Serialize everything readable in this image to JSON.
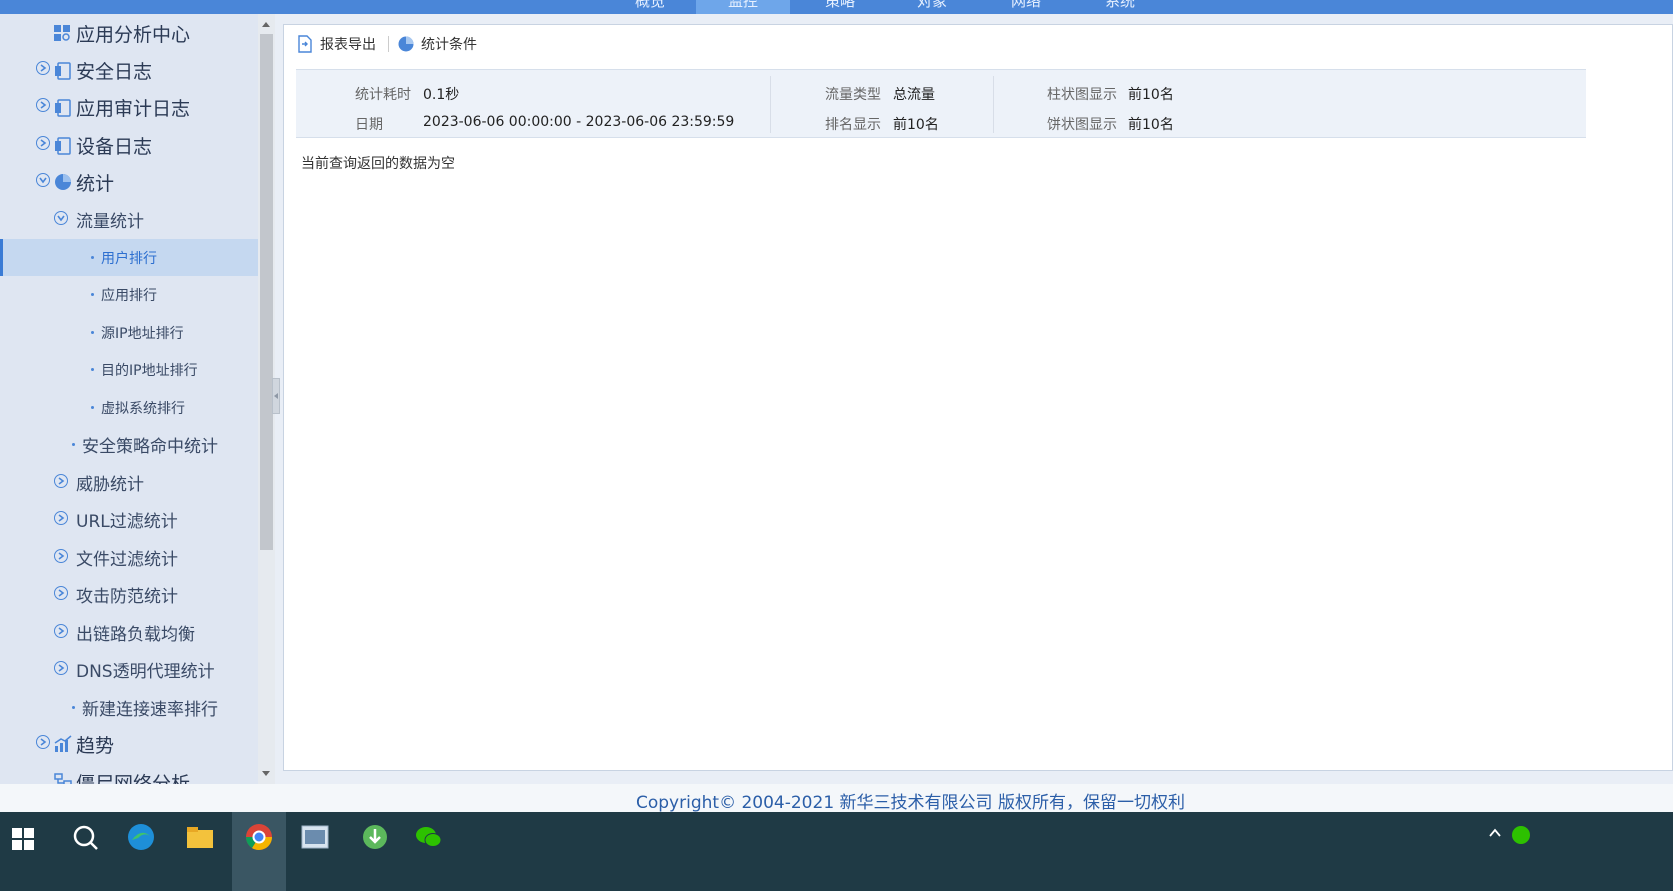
{
  "topnav": {
    "tabs": [
      {
        "label": "概览",
        "active": false
      },
      {
        "label": "监控",
        "active": true
      },
      {
        "label": "策略",
        "active": false
      },
      {
        "label": "对象",
        "active": false
      },
      {
        "label": "网络",
        "active": false
      },
      {
        "label": "系统",
        "active": false
      }
    ]
  },
  "sidebar": {
    "items": [
      {
        "label": "应用分析中心",
        "level": 1
      },
      {
        "label": "安全日志",
        "level": 1
      },
      {
        "label": "应用审计日志",
        "level": 1
      },
      {
        "label": "设备日志",
        "level": 1
      },
      {
        "label": "统计",
        "level": 1
      },
      {
        "label": "流量统计",
        "level": 2
      },
      {
        "label": "用户排行",
        "level": 3,
        "active": true
      },
      {
        "label": "应用排行",
        "level": 3
      },
      {
        "label": "源IP地址排行",
        "level": 3
      },
      {
        "label": "目的IP地址排行",
        "level": 3
      },
      {
        "label": "虚拟系统排行",
        "level": 3
      },
      {
        "label": "安全策略命中统计",
        "level": 2
      },
      {
        "label": "威胁统计",
        "level": 2
      },
      {
        "label": "URL过滤统计",
        "level": 2
      },
      {
        "label": "文件过滤统计",
        "level": 2
      },
      {
        "label": "攻击防范统计",
        "level": 2
      },
      {
        "label": "出链路负载均衡",
        "level": 2
      },
      {
        "label": "DNS透明代理统计",
        "level": 2
      },
      {
        "label": "新建连接速率排行",
        "level": 2
      },
      {
        "label": "趋势",
        "level": 1
      },
      {
        "label": "僵尸网络分析",
        "level": 1
      }
    ]
  },
  "toolbar": {
    "export_label": "报表导出",
    "conditions_label": "统计条件"
  },
  "info": {
    "time_cost_key": "统计耗时",
    "time_cost_value": "0.1秒",
    "date_key": "日期",
    "date_value": "2023-06-06 00:00:00 - 2023-06-06 23:59:59",
    "traffic_type_key": "流量类型",
    "traffic_type_value": "总流量",
    "rank_display_key": "排名显示",
    "rank_display_value": "前10名",
    "bar_display_key": "柱状图显示",
    "bar_display_value": "前10名",
    "pie_display_key": "饼状图显示",
    "pie_display_value": "前10名"
  },
  "empty_message": "当前查询返回的数据为空",
  "footer": {
    "copyright": "Copyright© 2004-2021 新华三技术有限公司 版权所有，保留一切权利"
  },
  "colors": {
    "accent": "#4a86d8",
    "sidebar_bg": "#dfe6f2",
    "active_item_bg": "#c5d8f0",
    "taskbar_bg": "#1f3a45"
  }
}
